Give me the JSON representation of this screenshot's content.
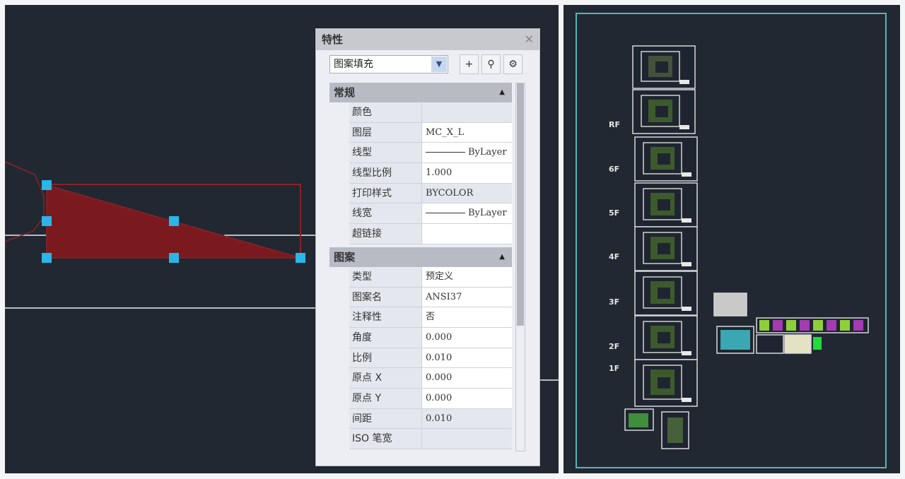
{
  "properties_palette": {
    "title": "特性",
    "close_icon": "close-icon",
    "object_type": "图案填充",
    "toolbar": [
      {
        "name": "toggle-pickadd-button",
        "icon": "plus-icon",
        "glyph": "+"
      },
      {
        "name": "select-objects-button",
        "icon": "select-objects-icon",
        "glyph": "⚲"
      },
      {
        "name": "quick-select-button",
        "icon": "quick-select-icon",
        "glyph": "⚙"
      }
    ],
    "sections": [
      {
        "title": "常规",
        "rows": [
          {
            "label": "颜色",
            "value": "",
            "readonly": true
          },
          {
            "label": "图层",
            "value": "MC_X_L"
          },
          {
            "label": "线型",
            "value": "ByLayer",
            "line_sample": true
          },
          {
            "label": "线型比例",
            "value": "1.000"
          },
          {
            "label": "打印样式",
            "value": "BYCOLOR",
            "readonly": true
          },
          {
            "label": "线宽",
            "value": "ByLayer",
            "line_sample": true
          },
          {
            "label": "超链接",
            "value": ""
          }
        ]
      },
      {
        "title": "图案",
        "rows": [
          {
            "label": "类型",
            "value": "预定义"
          },
          {
            "label": "图案名",
            "value": "ANSI37"
          },
          {
            "label": "注释性",
            "value": "否"
          },
          {
            "label": "角度",
            "value": "0.000"
          },
          {
            "label": "比例",
            "value": "0.010"
          },
          {
            "label": "原点 X",
            "value": "0.000"
          },
          {
            "label": "原点 Y",
            "value": "0.000"
          },
          {
            "label": "间距",
            "value": "0.010",
            "readonly": true
          },
          {
            "label": "ISO 笔宽",
            "value": "",
            "readonly": true
          }
        ]
      }
    ],
    "scroll": {
      "thumb_start_fraction": 0.0,
      "thumb_size_fraction": 0.66
    }
  },
  "colors": {
    "canvas_bg": "#222831",
    "hatch_fill": "#7a1a1f",
    "hatch_outline": "#8a2228",
    "grip": "#29b6e8",
    "line_gray": "#b8bcc2",
    "layout_border": "#58b3b5"
  },
  "right_view": {
    "floor_labels": [
      "RF",
      "6F",
      "5F",
      "4F",
      "3F",
      "2F",
      "1F"
    ]
  }
}
